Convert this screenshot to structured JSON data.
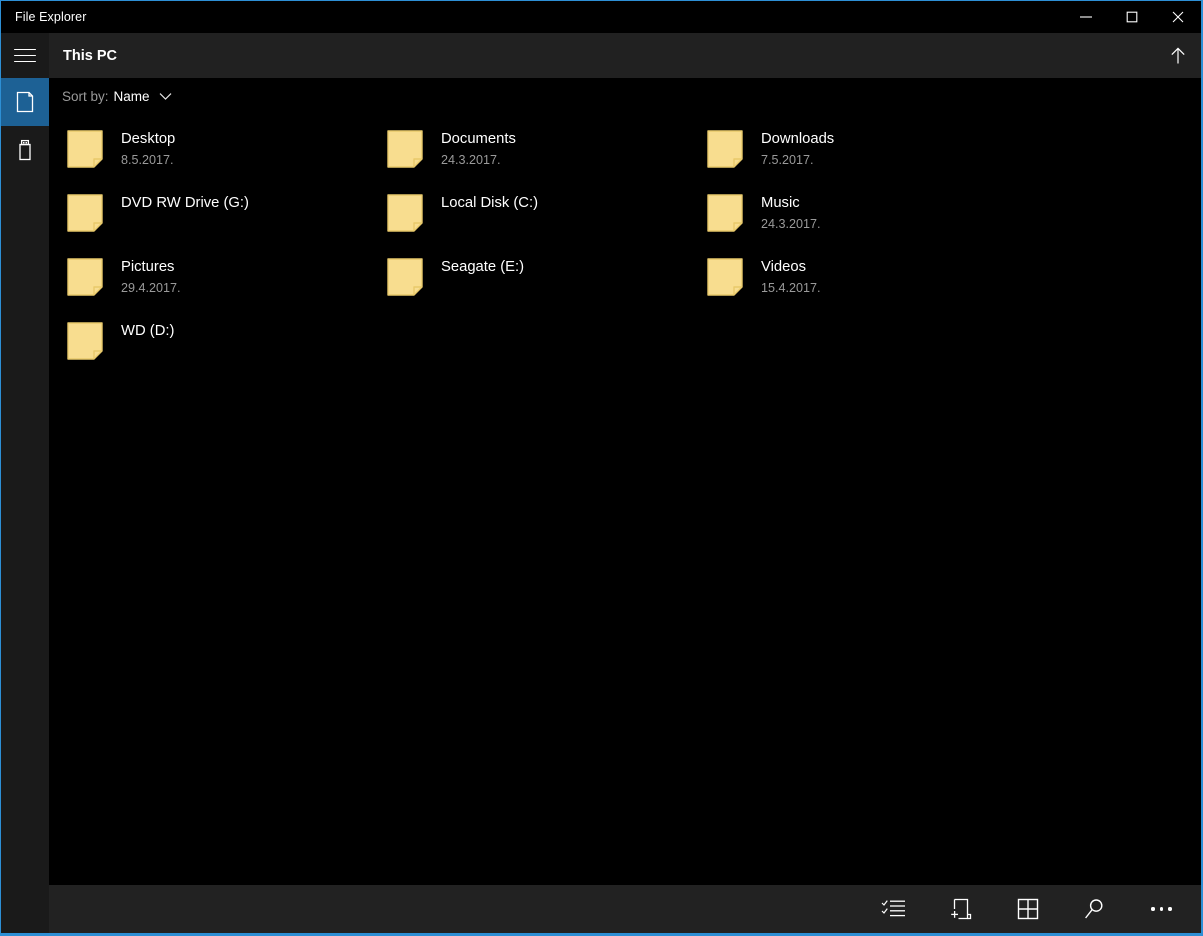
{
  "window": {
    "title": "File Explorer",
    "accent_color": "#2d8fd5",
    "controls": {
      "minimize": "Minimize",
      "maximize": "Maximize",
      "close": "Close"
    }
  },
  "header": {
    "menu_label": "Menu",
    "title": "This PC",
    "up_label": "Up"
  },
  "sidebar": {
    "items": [
      {
        "label": "This PC",
        "icon": "this-pc-icon",
        "selected": true
      },
      {
        "label": "Removable Drive",
        "icon": "usb-drive-icon",
        "selected": false
      }
    ]
  },
  "sortbar": {
    "label": "Sort by:",
    "value": "Name",
    "chevron": "chevron-down-icon"
  },
  "files": [
    {
      "name": "Desktop",
      "date": "8.5.2017.",
      "icon": "folder-icon"
    },
    {
      "name": "Documents",
      "date": "24.3.2017.",
      "icon": "folder-icon"
    },
    {
      "name": "Downloads",
      "date": "7.5.2017.",
      "icon": "folder-icon"
    },
    {
      "name": "DVD RW Drive (G:)",
      "date": "",
      "icon": "folder-icon"
    },
    {
      "name": "Local Disk (C:)",
      "date": "",
      "icon": "folder-icon"
    },
    {
      "name": "Music",
      "date": "24.3.2017.",
      "icon": "folder-icon"
    },
    {
      "name": "Pictures",
      "date": "29.4.2017.",
      "icon": "folder-icon"
    },
    {
      "name": "Seagate (E:)",
      "date": "",
      "icon": "folder-icon"
    },
    {
      "name": "Videos",
      "date": "15.4.2017.",
      "icon": "folder-icon"
    },
    {
      "name": "WD (D:)",
      "date": "",
      "icon": "folder-icon"
    }
  ],
  "commandbar": {
    "buttons": [
      {
        "label": "Select",
        "icon": "select-checklist-icon"
      },
      {
        "label": "New folder",
        "icon": "new-folder-icon"
      },
      {
        "label": "View",
        "icon": "view-grid-icon"
      },
      {
        "label": "Search",
        "icon": "search-icon"
      },
      {
        "label": "See more",
        "icon": "more-dots-icon"
      }
    ]
  },
  "colors": {
    "folder_fill": "#f8dd8f",
    "folder_edge": "#e8c96a",
    "sidebar_selected": "#1d6195",
    "text_primary": "#ffffff",
    "text_secondary": "#9a9a9a",
    "content_bg": "#000000",
    "chrome_bg": "#212121"
  }
}
